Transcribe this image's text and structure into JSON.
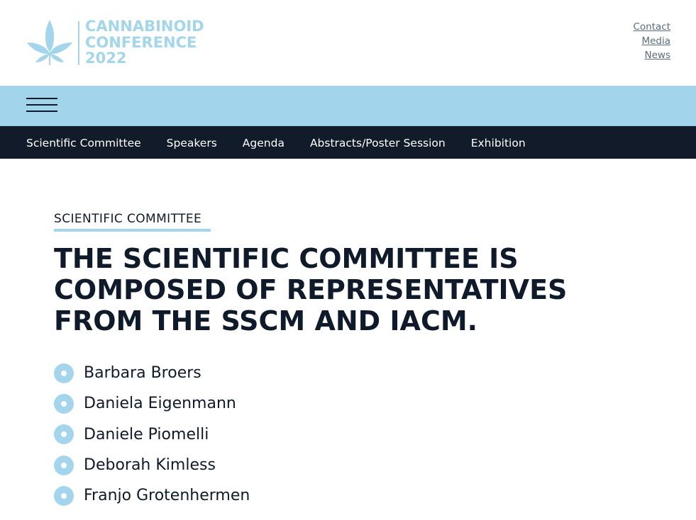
{
  "logo": {
    "line1": "CANNABINOID",
    "line2": "CONFERENCE",
    "line3": "2022",
    "icon": "cannabis-leaf-icon",
    "color": "#a3d6ec"
  },
  "utility_links": [
    {
      "label": "Contact"
    },
    {
      "label": "Media"
    },
    {
      "label": "News"
    }
  ],
  "menu": {
    "icon": "hamburger-menu-icon"
  },
  "nav": {
    "items": [
      {
        "label": "Scientific Committee"
      },
      {
        "label": "Speakers"
      },
      {
        "label": "Agenda"
      },
      {
        "label": "Abstracts/Poster Session"
      },
      {
        "label": "Exhibition"
      }
    ]
  },
  "main": {
    "eyebrow": "SCIENTIFIC COMMITTEE",
    "headline": "THE SCIENTIFIC COMMITTEE IS COMPOSED OF REPRESENTATIVES FROM THE SSCM AND IACM.",
    "members": [
      "Barbara Broers",
      "Daniela Eigenmann",
      "Daniele Piomelli",
      "Deborah Kimless",
      "Franjo Grotenhermen"
    ]
  },
  "colors": {
    "accent": "#a2d5ec",
    "nav_background": "#111b2a",
    "text": "#0f1b2a"
  }
}
